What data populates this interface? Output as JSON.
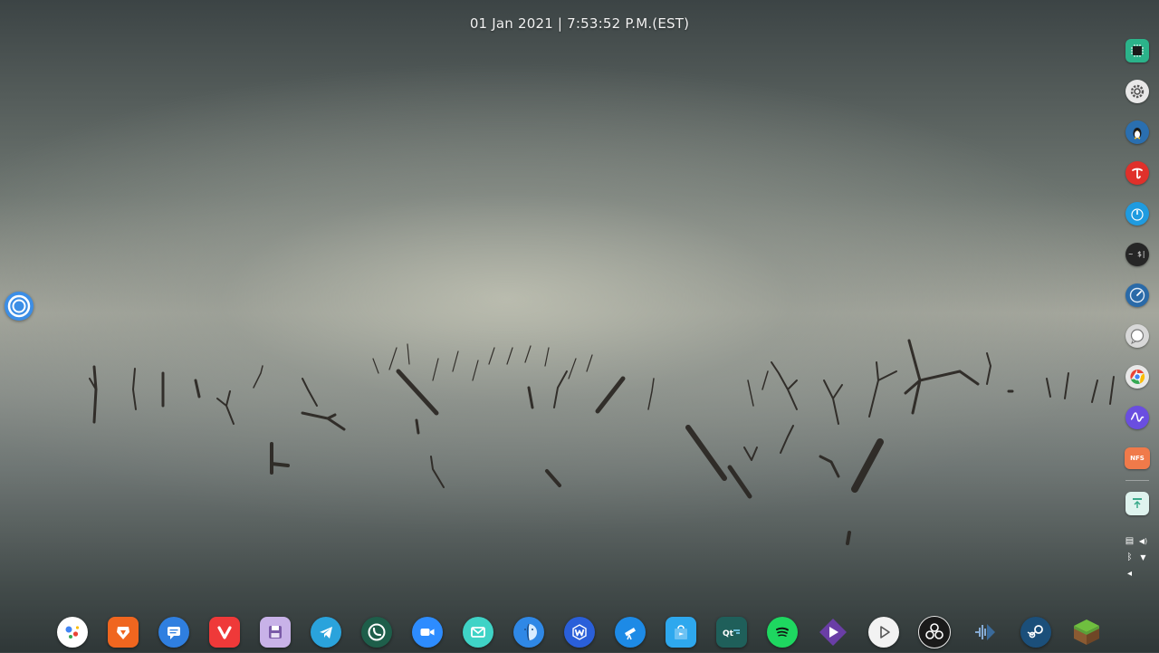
{
  "topbar": {
    "clock_text": "01 Jan 2021 | 7:53:52 P.M.(EST)"
  },
  "launcher": {
    "icon": "launcher-ring-icon",
    "color": "#3c8ee6"
  },
  "dock": {
    "items": [
      {
        "name": "google-assistant",
        "icon": "google-assistant-icon",
        "bg": "#ffffff"
      },
      {
        "name": "brave",
        "icon": "brave-lion-icon",
        "bg": "#f0661f"
      },
      {
        "name": "messages",
        "icon": "chat-bubble-icon",
        "bg": "#2f7fe0"
      },
      {
        "name": "vivaldi",
        "icon": "vivaldi-icon",
        "bg": "#ef3939"
      },
      {
        "name": "disks",
        "icon": "floppy-disk-icon",
        "bg": "#c8b2e8"
      },
      {
        "name": "telegram",
        "icon": "paper-plane-icon",
        "bg": "#2aa3dc"
      },
      {
        "name": "whatsapp",
        "icon": "phone-bubble-icon",
        "bg": "#1e5e4a"
      },
      {
        "name": "zoom",
        "icon": "video-camera-icon",
        "bg": "#2d8cff"
      },
      {
        "name": "mail",
        "icon": "envelope-icon",
        "bg": "#3fd3c6"
      },
      {
        "name": "files",
        "icon": "finder-face-icon",
        "bg": "#2f88e6"
      },
      {
        "name": "wps-office",
        "icon": "wps-w-icon",
        "bg": "#2a5fd9"
      },
      {
        "name": "stellarium",
        "icon": "telescope-icon",
        "bg": "#1d8ae6"
      },
      {
        "name": "software-store",
        "icon": "shopping-bag-icon",
        "bg": "#2ea8ee"
      },
      {
        "name": "qt-creator",
        "icon": "qt-logo-icon",
        "bg": "#1f5f5a"
      },
      {
        "name": "spotify",
        "icon": "spotify-icon",
        "bg": "#1ed760"
      },
      {
        "name": "kdenlive",
        "icon": "play-diamond-icon",
        "bg": "#6a3ea6"
      },
      {
        "name": "media-player",
        "icon": "play-circle-icon",
        "bg": "#f2f2f2"
      },
      {
        "name": "obs-studio",
        "icon": "obs-icon",
        "bg": "#1a1a1a"
      },
      {
        "name": "audio-editor",
        "icon": "waveform-arrow-icon",
        "bg": "#3a6a9a"
      },
      {
        "name": "steam",
        "icon": "steam-icon",
        "bg": "#1b4f7a"
      },
      {
        "name": "minecraft",
        "icon": "grass-block-icon",
        "bg": "#5aa03a"
      }
    ]
  },
  "sidebar": {
    "items": [
      {
        "name": "cpu-monitor",
        "icon": "cpu-chip-icon",
        "bg": "#2bb38a"
      },
      {
        "name": "settings",
        "icon": "gear-icon",
        "bg": "#e8e8e8"
      },
      {
        "name": "linux-app",
        "icon": "tux-penguin-icon",
        "bg": "#2a6fb0"
      },
      {
        "name": "red-app",
        "icon": "red-letter-icon",
        "bg": "#e0302a"
      },
      {
        "name": "timer",
        "icon": "stopwatch-icon",
        "bg": "#1f9be0"
      },
      {
        "name": "terminal",
        "icon": "terminal-icon",
        "bg": "#262626",
        "glyph": "~ $|"
      },
      {
        "name": "speed-monitor",
        "icon": "speedometer-icon",
        "bg": "#2a6aa8"
      },
      {
        "name": "chat",
        "icon": "speech-bubble-icon",
        "bg": "#d8d8d8"
      },
      {
        "name": "chrome",
        "icon": "chrome-icon",
        "bg": "#e8e8e8"
      },
      {
        "name": "audio-wave",
        "icon": "waveform-icon",
        "bg": "#6a4ee0"
      },
      {
        "name": "nfs-folder",
        "icon": "nfs-folder-icon",
        "bg": "#f07a4a",
        "glyph": "NFS"
      },
      {
        "name": "trash",
        "icon": "recycle-bin-icon",
        "bg": "#dff3ee"
      }
    ]
  },
  "tray": {
    "items": [
      {
        "name": "clipboard",
        "icon": "clipboard-icon",
        "glyph": "▤"
      },
      {
        "name": "volume",
        "icon": "speaker-icon",
        "glyph": "◀)"
      },
      {
        "name": "bluetooth",
        "icon": "bluetooth-icon",
        "glyph": "ᛒ"
      },
      {
        "name": "network",
        "icon": "wifi-icon",
        "glyph": "▼"
      },
      {
        "name": "expand",
        "icon": "chevron-left-icon",
        "glyph": "◂"
      }
    ]
  }
}
